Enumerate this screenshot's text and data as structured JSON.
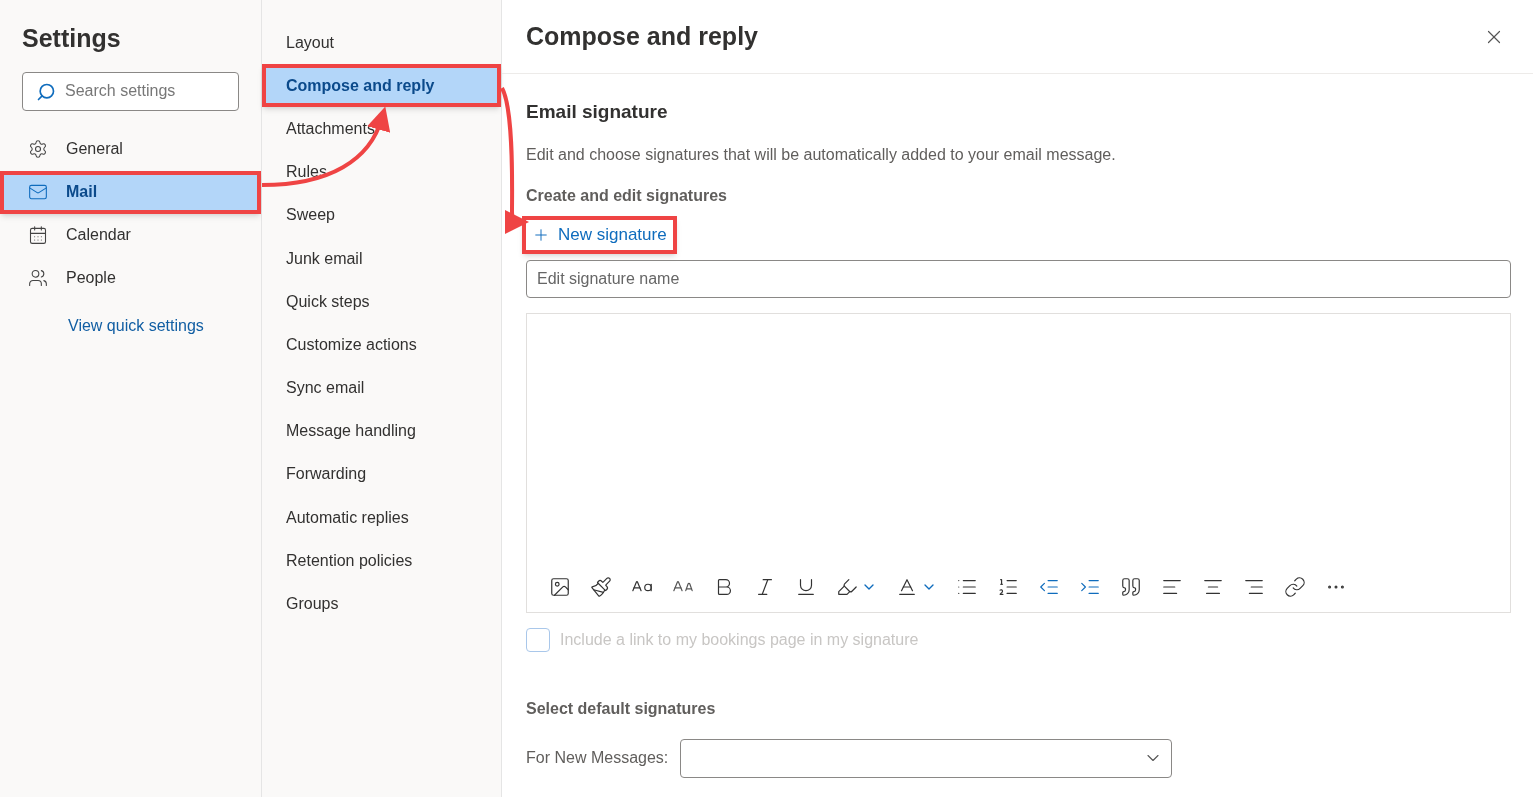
{
  "settings": {
    "title": "Settings",
    "search": {
      "placeholder": "Search settings"
    },
    "categories": [
      {
        "kind": "gear",
        "label": "General",
        "selected": false,
        "highlighted": false
      },
      {
        "kind": "mail",
        "label": "Mail",
        "selected": true,
        "highlighted": true
      },
      {
        "kind": "calendar",
        "label": "Calendar",
        "selected": false,
        "highlighted": false
      },
      {
        "kind": "people",
        "label": "People",
        "selected": false,
        "highlighted": false
      }
    ],
    "link": "View quick settings"
  },
  "submenu": {
    "items": [
      {
        "label": "Layout",
        "selected": false,
        "highlighted": false
      },
      {
        "label": "Compose and reply",
        "selected": true,
        "highlighted": true
      },
      {
        "label": "Attachments",
        "selected": false,
        "highlighted": false
      },
      {
        "label": "Rules",
        "selected": false,
        "highlighted": false
      },
      {
        "label": "Sweep",
        "selected": false,
        "highlighted": false
      },
      {
        "label": "Junk email",
        "selected": false,
        "highlighted": false
      },
      {
        "label": "Quick steps",
        "selected": false,
        "highlighted": false
      },
      {
        "label": "Customize actions",
        "selected": false,
        "highlighted": false
      },
      {
        "label": "Sync email",
        "selected": false,
        "highlighted": false
      },
      {
        "label": "Message handling",
        "selected": false,
        "highlighted": false
      },
      {
        "label": "Forwarding",
        "selected": false,
        "highlighted": false
      },
      {
        "label": "Automatic replies",
        "selected": false,
        "highlighted": false
      },
      {
        "label": "Retention policies",
        "selected": false,
        "highlighted": false
      },
      {
        "label": "Groups",
        "selected": false,
        "highlighted": false
      }
    ]
  },
  "panel": {
    "title": "Compose and reply",
    "section": "Email signature",
    "description": "Edit and choose signatures that will be automatically added to your email message.",
    "subheading": "Create and edit signatures",
    "new_signature": {
      "label": "New signature",
      "highlighted": true
    },
    "name_field": {
      "placeholder": "Edit signature name"
    },
    "bookings_checkbox": {
      "label": "Include a link to my bookings page in my signature",
      "checked": false,
      "disabled": true
    },
    "defaults_heading": "Select default signatures",
    "for_new_messages": {
      "label": "For New Messages:"
    }
  }
}
